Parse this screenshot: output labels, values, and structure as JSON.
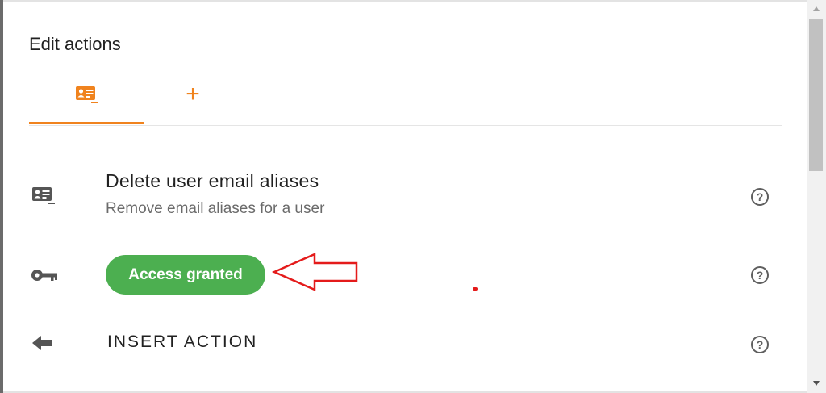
{
  "header": {
    "title": "Edit actions"
  },
  "tabs": [
    {
      "name": "user-card-tab",
      "icon": "contact-card-icon",
      "active": true
    },
    {
      "name": "add-tab",
      "icon": "plus-icon",
      "label": "+"
    }
  ],
  "rows": {
    "action": {
      "icon": "contact-card-icon",
      "title": "Delete user email aliases",
      "subtitle": "Remove email aliases for a user",
      "help": "?"
    },
    "access": {
      "icon": "key-icon",
      "badge": "Access granted",
      "badge_color": "#4caf50",
      "help": "?"
    },
    "insert": {
      "icon": "arrow-left-icon",
      "label": "INSERT ACTION",
      "help": "?"
    }
  },
  "colors": {
    "accent": "#f0831e",
    "annotation": "#e41b1b"
  },
  "annotation": {
    "type": "arrow-pointing-left",
    "target": "access-granted-badge"
  }
}
